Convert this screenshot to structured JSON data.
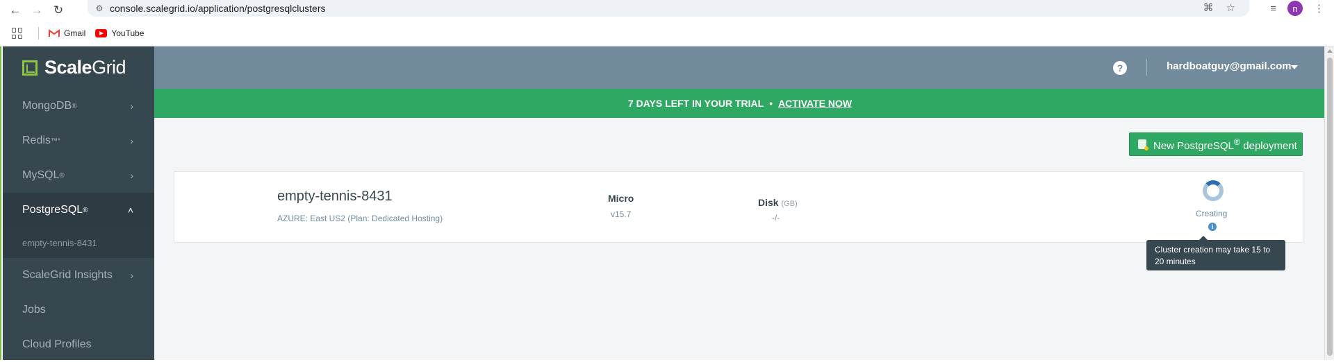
{
  "browser": {
    "url": "console.scalegrid.io/application/postgresqlclusters",
    "profile_initial": "n",
    "bookmarks": [
      {
        "label": "Gmail",
        "icon": "gmail-icon"
      },
      {
        "label": "YouTube",
        "icon": "youtube-icon"
      }
    ]
  },
  "brand": {
    "name_bold": "Scale",
    "name_light": "Grid",
    "accent_color": "#8dc63f"
  },
  "sidebar": {
    "items": [
      {
        "label": "MongoDB",
        "mark": "®"
      },
      {
        "label": "Redis",
        "mark": "™*"
      },
      {
        "label": "MySQL",
        "mark": "®"
      },
      {
        "label": "PostgreSQL",
        "mark": "®"
      },
      {
        "label": "ScaleGrid Insights",
        "mark": ""
      },
      {
        "label": "Jobs",
        "mark": ""
      },
      {
        "label": "Cloud Profiles",
        "mark": ""
      }
    ],
    "active_sub_item": "empty-tennis-8431"
  },
  "header": {
    "user_email": "hardboatguy@gmail.com",
    "help_symbol": "?"
  },
  "trial_banner": {
    "message": "7 DAYS LEFT IN YOUR TRIAL",
    "separator": "•",
    "action": "ACTIVATE NOW",
    "color": "#2ea862"
  },
  "toolbar": {
    "new_deployment_label": "New PostgreSQL",
    "new_deployment_mark": "®",
    "new_deployment_suffix": " deployment"
  },
  "cluster": {
    "name": "empty-tennis-8431",
    "region": "AZURE: East US2 (Plan: Dedicated Hosting)",
    "plan": "Micro",
    "version": "v15.7",
    "disk_label": "Disk",
    "disk_unit": "(GB)",
    "disk_value": "-/-",
    "status": "Creating",
    "info_symbol": "i",
    "tooltip": "Cluster creation may take 15 to 20 minutes"
  }
}
